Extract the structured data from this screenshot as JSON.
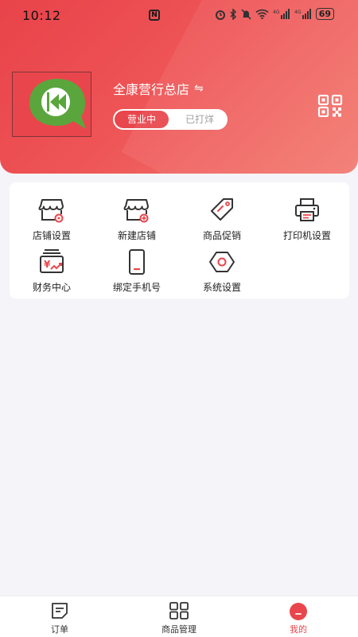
{
  "status_bar": {
    "time": "10:12",
    "nfc": "N",
    "battery": "69"
  },
  "store": {
    "name": "全康营行总店",
    "status_open": "营业中",
    "status_closed": "已打烊"
  },
  "menu": {
    "items": [
      {
        "label": "店铺设置",
        "icon": "store-settings-icon"
      },
      {
        "label": "新建店铺",
        "icon": "new-store-icon"
      },
      {
        "label": "商品促销",
        "icon": "tag-icon"
      },
      {
        "label": "打印机设置",
        "icon": "printer-icon"
      },
      {
        "label": "财务中心",
        "icon": "finance-icon"
      },
      {
        "label": "绑定手机号",
        "icon": "phone-icon"
      },
      {
        "label": "系统设置",
        "icon": "hexagon-settings-icon"
      }
    ]
  },
  "tabbar": {
    "orders": "订单",
    "products": "商品管理",
    "mine": "我的"
  },
  "colors": {
    "brand": "#e8464c",
    "background": "#f5f4f8"
  }
}
